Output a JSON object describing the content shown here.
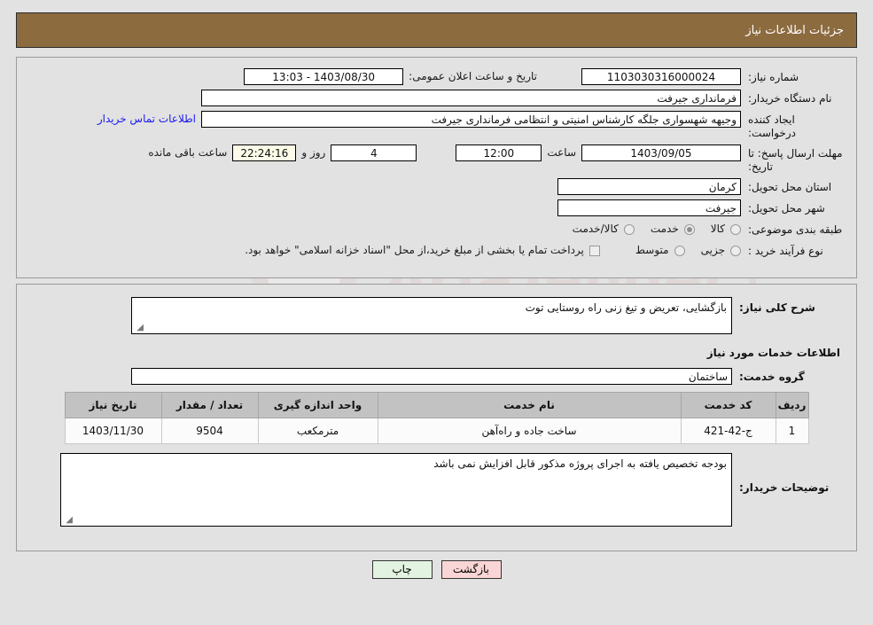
{
  "header": {
    "title": "جزئیات اطلاعات نیاز",
    "bar_color": "#8c6b3f"
  },
  "watermark": {
    "text": "AriaTender.net"
  },
  "form": {
    "need_number_label": "شماره نیاز:",
    "need_number_value": "1103030316000024",
    "public_announce_label": "تاریخ و ساعت اعلان عمومی:",
    "public_announce_value": "1403/08/30 - 13:03",
    "buyer_org_label": "نام دستگاه خریدار:",
    "buyer_org_value": "فرمانداری جیرفت",
    "requester_label": "ایجاد کننده درخواست:",
    "requester_value": "وجیهه شهسواری جلگه کارشناس امنیتی و انتظامی فرمانداری جیرفت",
    "contact_link": "اطلاعات تماس خریدار",
    "deadline_label": "مهلت ارسال پاسخ: تا تاریخ:",
    "deadline_date": "1403/09/05",
    "hour_label": "ساعت",
    "deadline_time": "12:00",
    "days_remaining": "4",
    "days_label": "روز و",
    "time_remaining": "22:24:16",
    "remaining_label": "ساعت باقی مانده",
    "province_label": "استان محل تحویل:",
    "province_value": "کرمان",
    "city_label": "شهر محل تحویل:",
    "city_value": "جیرفت",
    "category_label": "طبقه بندی موضوعی:",
    "category_options": [
      {
        "label": "کالا",
        "selected": false
      },
      {
        "label": "خدمت",
        "selected": true
      },
      {
        "label": "کالا/خدمت",
        "selected": false
      }
    ],
    "purchase_type_label": "نوع فرآیند خرید :",
    "purchase_type_options": [
      {
        "label": "جزیی",
        "selected": false
      },
      {
        "label": "متوسط",
        "selected": false
      }
    ],
    "treasury_checkbox_label": "پرداخت تمام یا بخشی از مبلغ خرید،از محل \"اسناد خزانه اسلامی\" خواهد بود.",
    "treasury_checked": false
  },
  "details": {
    "general_desc_label": "شرح کلی نیاز:",
    "general_desc_value": "بازگشایی، تعریض و تیغ زنی راه روستایی توت",
    "services_section_title": "اطلاعات خدمات مورد نیاز",
    "service_group_label": "گروه خدمت:",
    "service_group_value": "ساختمان",
    "buyer_notes_label": "توضیحات خریدار:",
    "buyer_notes_value": "بودجه تخصیص یافته به اجرای پروژه مذکور قابل افزایش نمی باشد"
  },
  "table": {
    "columns": [
      "ردیف",
      "کد خدمت",
      "نام خدمت",
      "واحد اندازه گیری",
      "تعداد / مقدار",
      "تاریخ نیاز"
    ],
    "rows": [
      {
        "index": "1",
        "code": "ج-42-421",
        "name": "ساخت جاده و راه‌آهن",
        "unit": "مترمکعب",
        "quantity": "9504",
        "need_date": "1403/11/30"
      }
    ]
  },
  "footer": {
    "back_label": "بازگشت",
    "print_label": "چاپ"
  }
}
